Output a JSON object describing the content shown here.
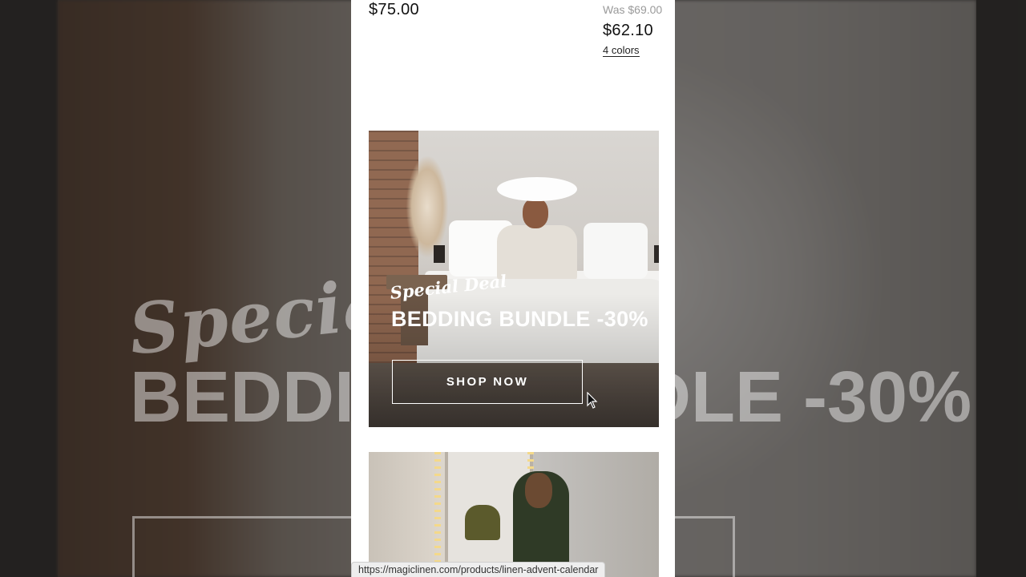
{
  "background": {
    "script_text": "Special Deal",
    "headline": "BEDDING BUNDLE -30%"
  },
  "product_prices": {
    "left_price": "$75.00",
    "right_was_price": "Was $69.00",
    "right_price": "$62.10",
    "right_colors": "4 colors"
  },
  "promo_banner": {
    "script_title": "Special Deal",
    "headline": "BEDDING BUNDLE -30%",
    "cta_label": "SHOP NOW"
  },
  "status_bar": {
    "url": "https://magiclinen.com/products/linen-advent-calendar"
  },
  "colors": {
    "page_bg": "#ffffff",
    "text_primary": "#111111",
    "text_muted": "#9a9a9a",
    "cta_border": "#ffffff"
  }
}
